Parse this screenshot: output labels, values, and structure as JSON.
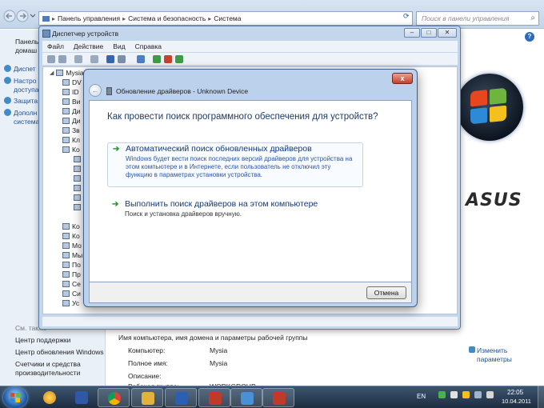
{
  "control_panel": {
    "breadcrumb": [
      "Панель управления",
      "Система и безопасность",
      "Система"
    ],
    "search_placeholder": "Поиск в панели управления",
    "sidebar": {
      "home_link": "Панель управления — домашняя страница",
      "home_line1": "Панель",
      "home_line2": "домаш",
      "tasks": [
        {
          "line1": "Диспет",
          "line2": ""
        },
        {
          "line1": "Настро",
          "line2": "доступа"
        },
        {
          "line1": "Защита",
          "line2": ""
        },
        {
          "line1": "Дополн",
          "line2": "система"
        }
      ],
      "see_also": "См. также",
      "links": [
        "Центр поддержки",
        "Центр обновления Windows",
        "Счетчики и средства",
        "производительности"
      ]
    },
    "brand": "ASUS",
    "computer_info": {
      "heading": "Имя компьютера, имя домена и параметры рабочей группы",
      "rows": [
        {
          "label": "Компьютер:",
          "value": "Mysia"
        },
        {
          "label": "Полное имя:",
          "value": "Mysia"
        },
        {
          "label": "Описание:",
          "value": ""
        },
        {
          "label": "Рабочая группа:",
          "value": "WORKGROUP"
        }
      ],
      "change_line1": "Изменить",
      "change_line2": "параметры"
    }
  },
  "device_manager": {
    "title": "Диспетчер устройств",
    "menu": [
      "Файл",
      "Действие",
      "Вид",
      "Справка"
    ],
    "tree_root": "Mysia",
    "tree_items": [
      "DV",
      "ID",
      "Ви",
      "Ди",
      "Ди",
      "Зв",
      "Кл",
      "Ко",
      "",
      "",
      "",
      "",
      "",
      "",
      "Ко",
      "Ко",
      "Мо",
      "Мы",
      "По",
      "Пр",
      "Се",
      "Си",
      "Ус"
    ]
  },
  "driver_dialog": {
    "title": "Обновление драйверов - Unknown Device",
    "heading": "Как провести поиск программного обеспечения для устройств?",
    "option_auto": {
      "title": "Автоматический поиск обновленных драйверов",
      "description": "Windows будет вести поиск последних версий драйверов для устройства на этом компьютере и в Интернете, если пользователь не отключил эту функцию в параметрах установки устройства."
    },
    "option_manual": {
      "title": "Выполнить поиск драйверов на этом компьютере",
      "description": "Поиск и установка драйверов вручную."
    },
    "cancel_label": "Отмена",
    "close_label": "x"
  },
  "taskbar": {
    "language": "EN",
    "time": "22:05",
    "date": "10.04.2011"
  },
  "colors": {
    "accent": "#2e6bbd",
    "option_arrow": "#2c9a2c",
    "close_button": "#c2412d"
  }
}
